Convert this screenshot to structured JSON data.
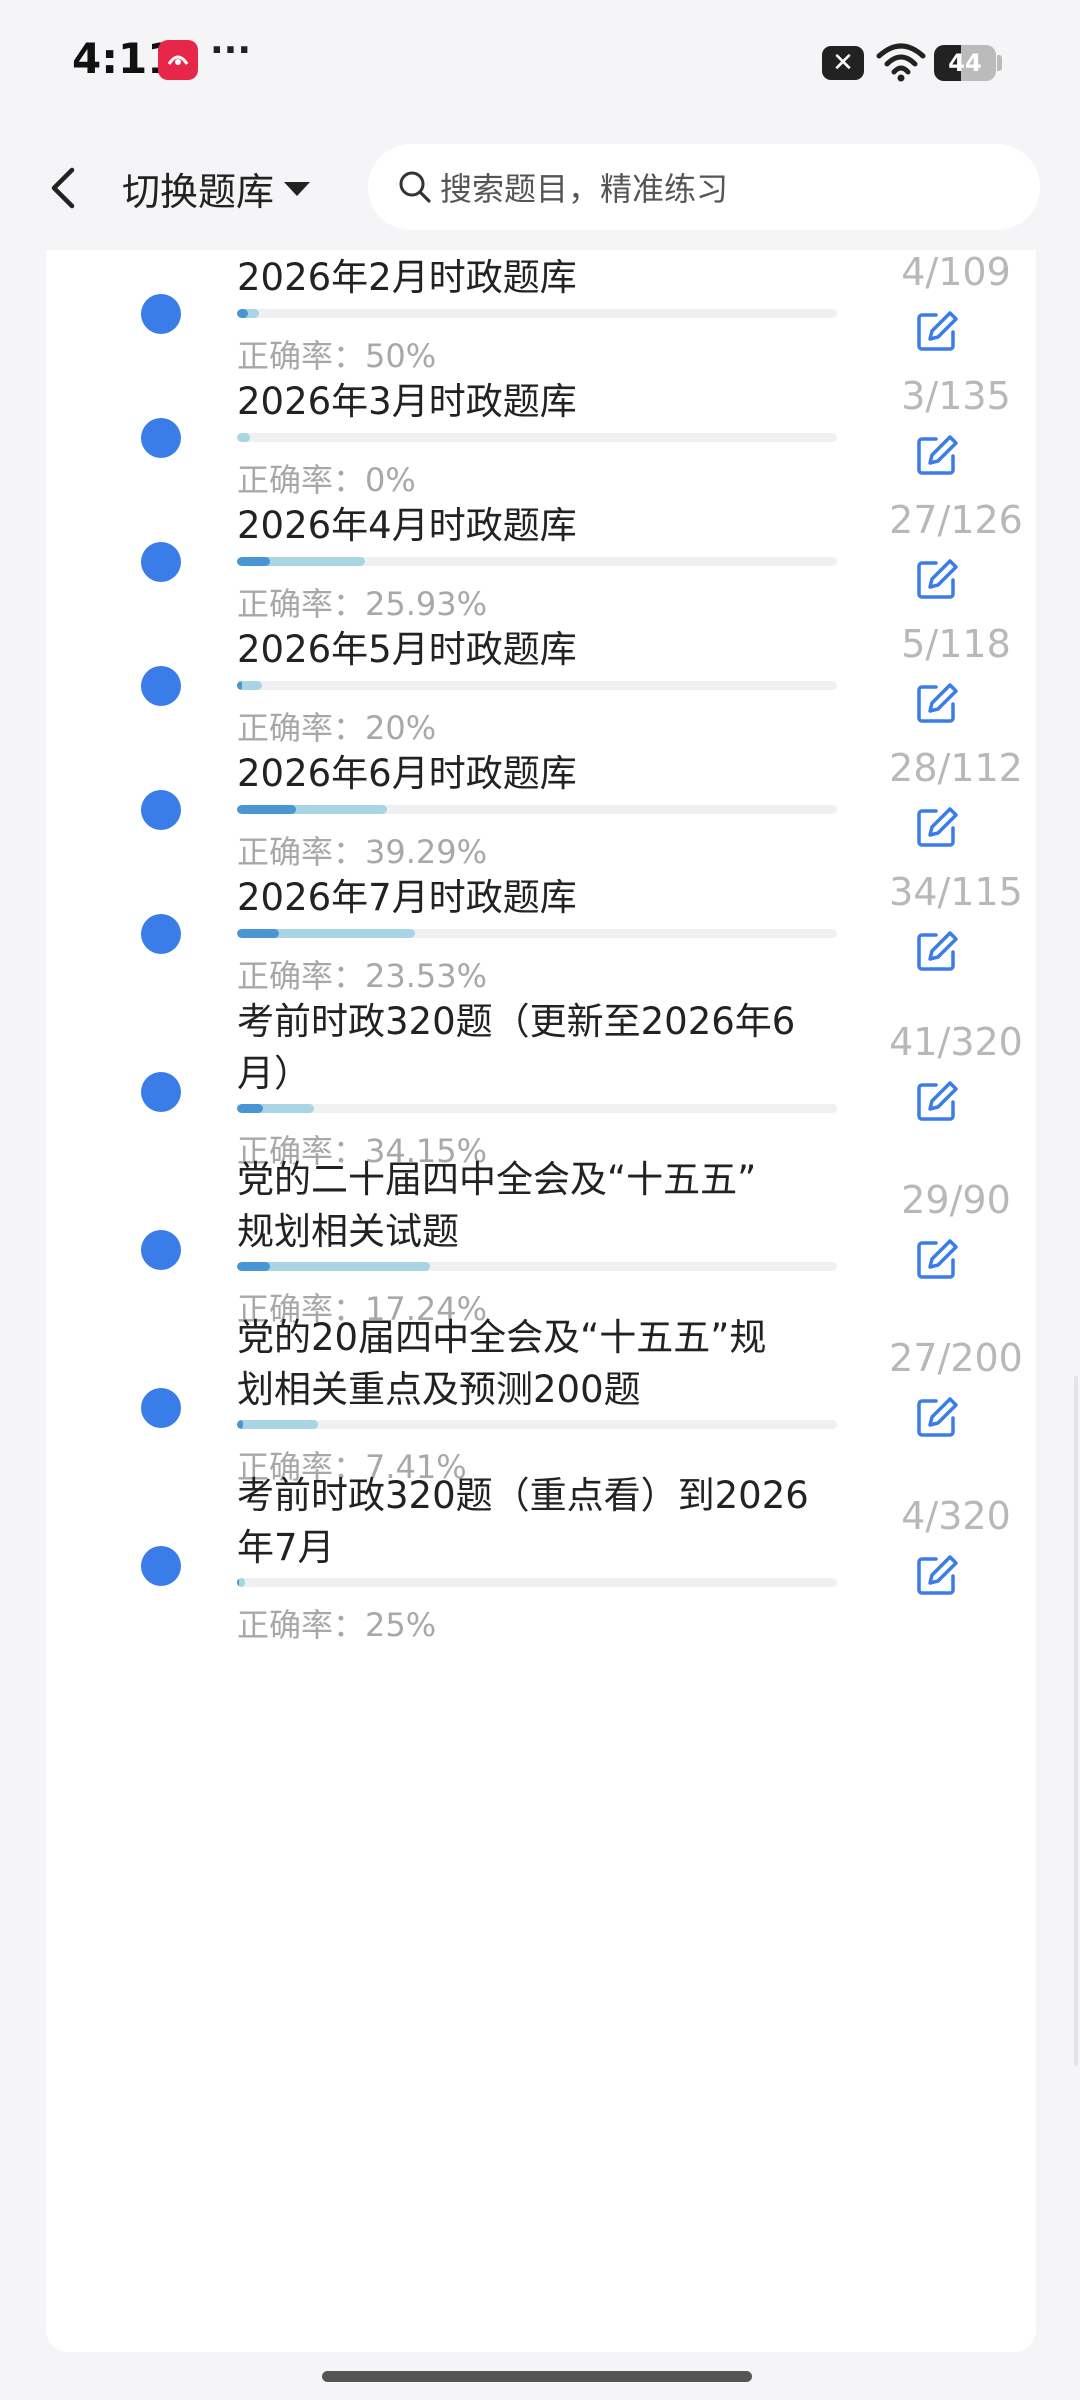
{
  "status_bar": {
    "time": "4:11",
    "more": "···",
    "notification_icon": "close-badge-icon",
    "battery": "44",
    "battery_level": 0.44
  },
  "header": {
    "back_icon": "chevron-left-icon",
    "switch_label": "切换题库",
    "search_placeholder": "搜索题目，精准练习"
  },
  "colors": {
    "dot": "#3a7de8",
    "progress_dark": "#4a96d4",
    "progress_light": "#a9d4e4",
    "count_text": "#b8b8ba",
    "rate_text": "#a8a8aa",
    "edit_icon": "#3a7de8"
  },
  "items": [
    {
      "title_lines": [
        "2026年2月时政题库"
      ],
      "count": "4/109",
      "rate": "正确率：50%",
      "progress": 0.037,
      "accuracy": 0.5
    },
    {
      "title_lines": [
        "2026年3月时政题库"
      ],
      "count": "3/135",
      "rate": "正确率：0%",
      "progress": 0.022,
      "accuracy": 0.0
    },
    {
      "title_lines": [
        "2026年4月时政题库"
      ],
      "count": "27/126",
      "rate": "正确率：25.93%",
      "progress": 0.214,
      "accuracy": 0.2593
    },
    {
      "title_lines": [
        "2026年5月时政题库"
      ],
      "count": "5/118",
      "rate": "正确率：20%",
      "progress": 0.042,
      "accuracy": 0.2
    },
    {
      "title_lines": [
        "2026年6月时政题库"
      ],
      "count": "28/112",
      "rate": "正确率：39.29%",
      "progress": 0.25,
      "accuracy": 0.3929
    },
    {
      "title_lines": [
        "2026年7月时政题库"
      ],
      "count": "34/115",
      "rate": "正确率：23.53%",
      "progress": 0.296,
      "accuracy": 0.2353
    },
    {
      "title_lines": [
        "考前时政320题（更新至2026年6",
        "月）"
      ],
      "count": "41/320",
      "rate": "正确率：34.15%",
      "progress": 0.128,
      "accuracy": 0.3415
    },
    {
      "title_lines": [
        "党的二十届四中全会及“十五五”",
        "规划相关试题"
      ],
      "count": "29/90",
      "rate": "正确率：17.24%",
      "progress": 0.322,
      "accuracy": 0.1724
    },
    {
      "title_lines": [
        "党的20届四中全会及“十五五”规",
        "划相关重点及预测200题"
      ],
      "count": "27/200",
      "rate": "正确率：7.41%",
      "progress": 0.135,
      "accuracy": 0.0741
    },
    {
      "title_lines": [
        "考前时政320题（重点看）到2026",
        "年7月"
      ],
      "count": "4/320",
      "rate": "正确率：25%",
      "progress": 0.0125,
      "accuracy": 0.25
    }
  ]
}
